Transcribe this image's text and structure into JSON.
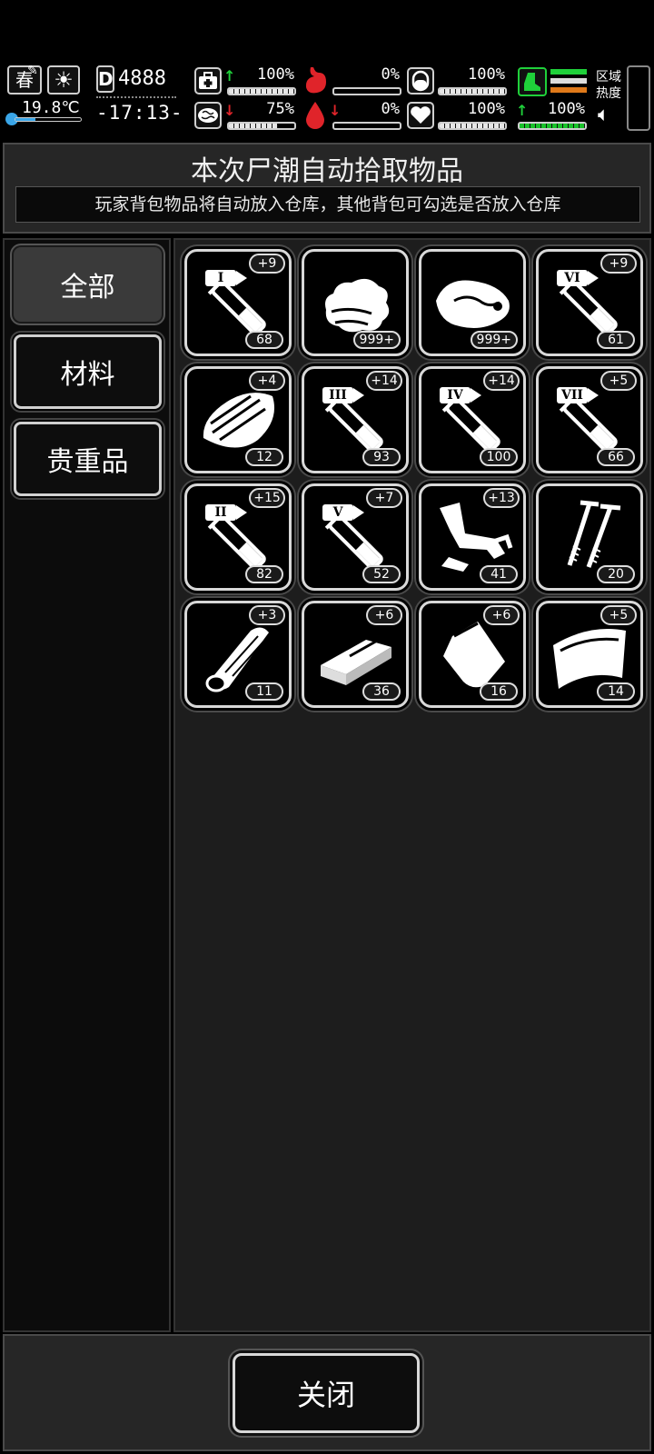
{
  "status": {
    "season": "春",
    "temperature": "19.8℃",
    "day": "4888",
    "time": "-17:13-",
    "health": "100%",
    "mood": "75%",
    "hunger": "0%",
    "bleed": "0%",
    "stamina": "100%",
    "heart": "100%",
    "energy": "100%",
    "area_heat_label": "区域热度",
    "colors": {
      "green": "#1fd03a",
      "red": "#e0242a",
      "orange": "#e07a1a"
    }
  },
  "header": {
    "title": "本次尸潮自动拾取物品",
    "subtitle": "玩家背包物品将自动放入仓库，其他背包可勾选是否放入仓库"
  },
  "tabs": [
    {
      "label": "全部",
      "active": true
    },
    {
      "label": "材料",
      "active": false
    },
    {
      "label": "贵重品",
      "active": false
    }
  ],
  "items": [
    {
      "icon": "syringe-tier-1-icon",
      "tier": "I",
      "bonus": "+9",
      "count": "68"
    },
    {
      "icon": "cloth-icon",
      "tier": "",
      "bonus": "",
      "count": "999+"
    },
    {
      "icon": "raw-meat-icon",
      "tier": "",
      "bonus": "",
      "count": "999+"
    },
    {
      "icon": "syringe-tier-6-icon",
      "tier": "VI",
      "bonus": "+9",
      "count": "61"
    },
    {
      "icon": "wood-plank-icon",
      "tier": "",
      "bonus": "+4",
      "count": "12"
    },
    {
      "icon": "syringe-tier-3-icon",
      "tier": "III",
      "bonus": "+14",
      "count": "93"
    },
    {
      "icon": "syringe-tier-4-icon",
      "tier": "IV",
      "bonus": "+14",
      "count": "100"
    },
    {
      "icon": "syringe-tier-7-icon",
      "tier": "VII",
      "bonus": "+5",
      "count": "66"
    },
    {
      "icon": "syringe-tier-2-icon",
      "tier": "II",
      "bonus": "+15",
      "count": "82"
    },
    {
      "icon": "syringe-tier-5-icon",
      "tier": "V",
      "bonus": "+7",
      "count": "52"
    },
    {
      "icon": "scrap-metal-icon",
      "tier": "",
      "bonus": "+13",
      "count": "41"
    },
    {
      "icon": "nails-icon",
      "tier": "",
      "bonus": "",
      "count": "20"
    },
    {
      "icon": "log-icon",
      "tier": "",
      "bonus": "+3",
      "count": "11"
    },
    {
      "icon": "whetstone-icon",
      "tier": "",
      "bonus": "+6",
      "count": "36"
    },
    {
      "icon": "pouch-icon",
      "tier": "",
      "bonus": "+6",
      "count": "16"
    },
    {
      "icon": "fabric-sheet-icon",
      "tier": "",
      "bonus": "+5",
      "count": "14"
    }
  ],
  "footer": {
    "close_label": "关闭"
  }
}
